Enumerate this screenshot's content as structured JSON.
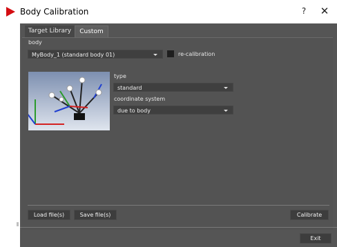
{
  "window": {
    "title": "Body Calibration",
    "help_label": "?",
    "close_label": "✕"
  },
  "tabs": [
    {
      "label": "Target Library"
    },
    {
      "label": "Custom"
    }
  ],
  "body_section": {
    "label": "body",
    "selected": "MyBody_1 (standard body 01)",
    "recalibration_label": "re-calibration",
    "recalibration_checked": false
  },
  "type_section": {
    "label": "type",
    "selected": "standard"
  },
  "coord_section": {
    "label": "coordinate system",
    "selected": "due to body"
  },
  "buttons": {
    "load": "Load file(s)",
    "save": "Save file(s)",
    "calibrate": "Calibrate",
    "exit": "Exit"
  },
  "colors": {
    "accent": "#d40d12",
    "panel": "#535353",
    "combo": "#3f3f3f"
  }
}
